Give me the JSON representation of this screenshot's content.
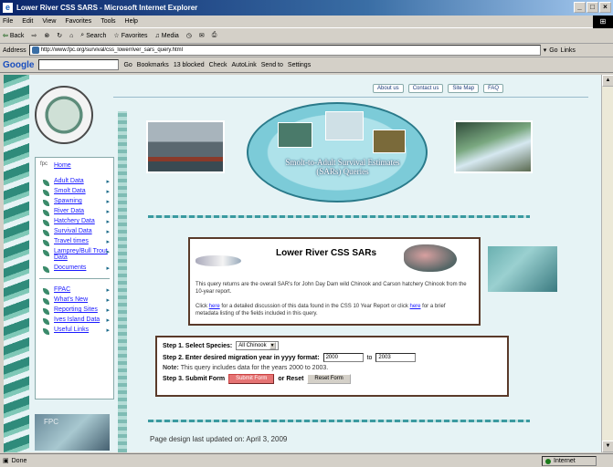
{
  "window": {
    "title": "Lower River CSS SARS - Microsoft Internet Explorer"
  },
  "menu": [
    "File",
    "Edit",
    "View",
    "Favorites",
    "Tools",
    "Help"
  ],
  "toolbar": {
    "back": "Back",
    "search": "Search",
    "favorites": "Favorites",
    "media": "Media"
  },
  "address": {
    "label": "Address",
    "url": "http://www.fpc.org/survival/css_lowerriver_sars_query.html",
    "go": "Go",
    "links": "Links"
  },
  "google": {
    "logo": "Google",
    "go": "Go",
    "bookmarks": "Bookmarks",
    "blocked": "13 blocked",
    "check": "Check",
    "autolink": "AutoLink",
    "sendto": "Send to",
    "settings": "Settings"
  },
  "topnav": [
    "About us",
    "Contact us",
    "Site Map",
    "FAQ"
  ],
  "sidebar": {
    "home": "Home",
    "items": [
      "Adult Data",
      "Smolt Data",
      "Spawning",
      "River Data",
      "Hatchery Data",
      "Survival Data",
      "Travel times",
      "Lamprey/Bull Trout Data",
      "Documents"
    ],
    "links": [
      "FPAC",
      "What's New",
      "Reporting Sites",
      "Ives Island Data",
      "Useful Links"
    ],
    "logo": "FPC"
  },
  "banner": {
    "title": "Smolt-to-Adult Survival Estimates (SARs) Queries"
  },
  "sars": {
    "heading": "Lower River CSS SARs",
    "description": "This query returns are the overall SAR's for John Day Dam wild Chinook and Carson hatchery Chinook from the 10-year report.",
    "link_pre1": "Click ",
    "link1": "here",
    "link_post1": " for a detailed discussion of this data found in the CSS 10 Year Report or",
    "link_pre2": "click ",
    "link2": "here",
    "link_post2": " for a brief metadata listing of the fields included in this query."
  },
  "form": {
    "step1": "Step 1. Select Species:",
    "species": "All Chinook",
    "step2": "Step 2.  Enter desired migration year in yyyy format:",
    "year_from": "2000",
    "to": "to",
    "year_to": "2003",
    "note_label": "Note:",
    "note": " This query includes data for the years 2000 to 2003.",
    "step3": "Step 3.  Submit Form",
    "submit": "Submit Form",
    "or_reset": "or Reset",
    "reset": "Reset Form"
  },
  "footer": {
    "updated": "Page design last updated on: April 3, 2009"
  },
  "status": {
    "text": "Done",
    "zone": "Internet"
  }
}
